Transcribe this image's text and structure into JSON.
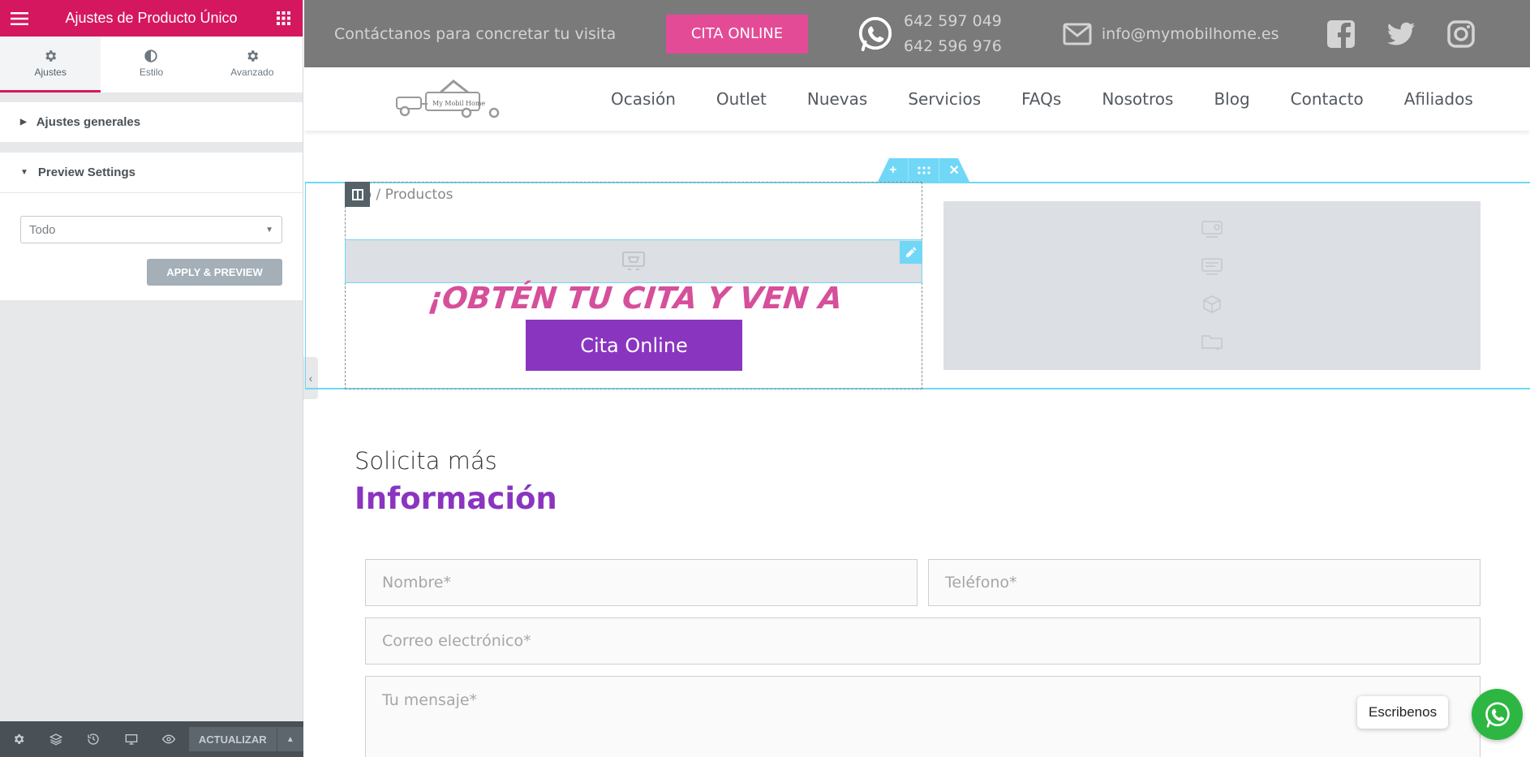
{
  "editor": {
    "title": "Ajustes de Producto Único",
    "tabs": [
      {
        "label": "Ajustes",
        "icon": "gear-icon"
      },
      {
        "label": "Estilo",
        "icon": "contrast-icon"
      },
      {
        "label": "Avanzado",
        "icon": "gear-icon"
      }
    ],
    "sections": {
      "general": "Ajustes generales",
      "preview": "Preview Settings"
    },
    "preview_select_value": "Todo",
    "apply_label": "APPLY & PREVIEW",
    "update_label": "ACTUALIZAR"
  },
  "topbar": {
    "contact_text": "Contáctanos para concretar tu visita",
    "cita_button": "CITA ONLINE",
    "phone1": "642 597 049",
    "phone2": "642 596 976",
    "email": "info@mymobilhome.es"
  },
  "logo": {
    "name": "My Mobil Home"
  },
  "nav": [
    "Ocasión",
    "Outlet",
    "Nuevas",
    "Servicios",
    "FAQs",
    "Nosotros",
    "Blog",
    "Contacto",
    "Afiliados"
  ],
  "content": {
    "breadcrumb": "io / Productos",
    "headline": "¡OBTÉN TU CITA Y VEN A VISITARLA!",
    "cita_online": "Cita Online"
  },
  "info": {
    "subtitle": "Solicita más",
    "title": "Información"
  },
  "form": {
    "nombre": "Nombre*",
    "telefono": "Teléfono*",
    "correo": "Correo electrónico*",
    "mensaje": "Tu mensaje*"
  },
  "chat": {
    "label": "Escribenos"
  },
  "colors": {
    "editor_accent": "#d5175f",
    "pink_button": "#e44b96",
    "purple": "#8a35c0",
    "handle_blue": "#71d7f7",
    "whatsapp": "#2db742"
  }
}
